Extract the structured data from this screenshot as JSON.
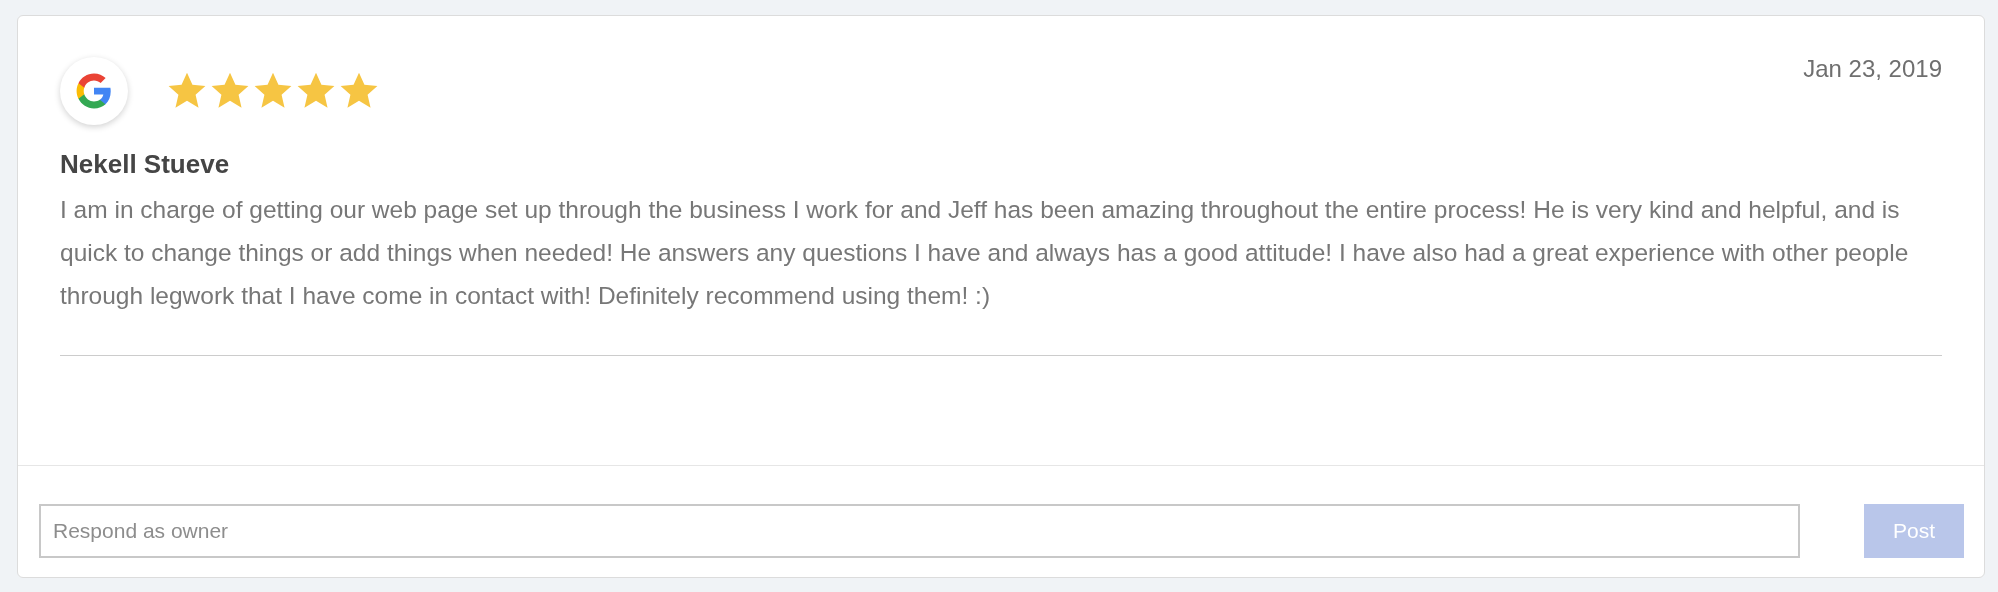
{
  "review": {
    "stars": 5,
    "date": "Jan 23, 2019",
    "author": "Nekell Stueve",
    "text": "I am in charge of getting our web page set up through the business I work for and Jeff has been amazing throughout the entire process! He is very kind and helpful, and is quick to change things or add things when needed! He answers any questions I have and always has a good attitude! I have also had a great experience with other people through legwork that I have come in contact with! Definitely recommend using them! :)"
  },
  "reply": {
    "placeholder": "Respond as owner",
    "button": {
      "label": "Post",
      "disabled": true
    }
  }
}
